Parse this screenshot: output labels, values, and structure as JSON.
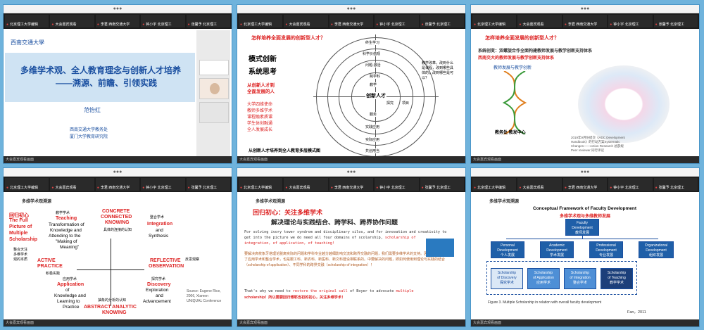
{
  "thumbs": [
    [
      "北京理工大学编辑",
      "大会嘉宾观看",
      "李君 西南交通大学",
      "钟小宇 北京理工",
      "张馨予 北京理工"
    ],
    [
      "北京理工大学编辑",
      "大会嘉宾观看",
      "李君 西南交通大学",
      "钟小宇 北京理工",
      "张馨予 北京理工"
    ],
    [
      "北京理工大学编辑",
      "大会嘉宾观看",
      "李君 西南交通大学",
      "钟小宇 北京理工",
      "张馨予 北京理工"
    ],
    [
      "北京理工大学编辑",
      "大会嘉宾观看",
      "李君 西南交通大学",
      "钟小宇 北京理工",
      "张馨予 北京理工"
    ],
    [
      "北京理工大学编辑",
      "大会嘉宾观看",
      "李君 西南交通大学",
      "钟小宇 北京理工",
      "张馨予 北京理工"
    ],
    [
      "北京理工大学编辑",
      "大会嘉宾观看",
      "李君 西南交通大学",
      "钟小宇 北京理工",
      "张馨予 北京理工"
    ]
  ],
  "bottom_label": "大会嘉宾观看画面",
  "p1": {
    "title_line1": "多维学术观、全人教育理念与创新人才培养",
    "title_line2": "——溯源、前瞻、引领实践",
    "speaker": "范怡红",
    "affil1": "西南交通大学教务处",
    "affil2": "厦门大学教育研究院"
  },
  "p2": {
    "heading": "怎样培养全面发展的创新型人才？",
    "left1": "模式创新",
    "left2": "系统思考",
    "red1": "从创新人才到",
    "red2": "全面发展的人",
    "list": [
      "大学四维使命",
      "教师多维学术",
      "课程融素质课",
      "学生体创融通",
      "全人发展成长"
    ],
    "footer": "从创新人才培养到全人教育多层模式图",
    "center": "创新人才",
    "rings": [
      "终生学习",
      "科学价值观",
      "问题-激活",
      "跨学科",
      "教学",
      "探究",
      "项目",
      "服务",
      "实践应用",
      "实际应用",
      "共创用当"
    ],
    "right_text": "教学改革，改到什么是课程，改到哪些具体的，改到哪些是可以？"
  },
  "p3": {
    "heading": "怎样培养全面发展的创新型人才？",
    "sys1": "系统创变：双螺旋合作全面构建教师发展与教学创新支持体系",
    "sys2": "西南交大的教师发展与教学创新支持体系",
    "left_label": "教师发展与教学创新",
    "bottom_left": "教务处  教发中心",
    "caption1": "2019年9月份提交《ADC Development",
    "caption2": "Handbook》的行动方案Systematic",
    "caption3": "Changes——Action Research 总部规",
    "caption4": "Peer reviewer 同行评议"
  },
  "p4": {
    "section": "多维学术观溯源",
    "l1": "回归初心",
    "l2": "The Full",
    "l3": "Picture of",
    "l4": "Multiple",
    "l5": "Scholarship",
    "l6": "整合天注",
    "l7": "多维学术",
    "l8": "观的本质",
    "teaching_label": "教学学术",
    "teaching": "Teaching",
    "teaching_desc1": "Transformation of",
    "teaching_desc2": "Knowledge and",
    "teaching_desc3": "Attending to the",
    "teaching_desc4": "\"Making of",
    "teaching_desc5": "Meaning\"",
    "concrete1": "CONCRETE",
    "concrete2": "CONNECTED",
    "concrete3": "KNOWING",
    "concrete_cn": "具体的连接的认知",
    "integration_label": "整合学术",
    "integration": "Integration",
    "integration2": "and",
    "integration3": "Synthesis",
    "active1": "ACTIVE",
    "active2": "PRACTICE",
    "active_cn": "积极实践",
    "reflective1": "REFLECTIVE",
    "reflective2": "OBSERVATION",
    "reflective_cn": "反思观察",
    "app_label": "应用学术",
    "application": "Application",
    "application2": "of",
    "application3": "Knowledge and",
    "application4": "Learning to",
    "application5": "Practice",
    "discovery_label": "探究学术",
    "discovery1": "Discovery",
    "discovery2": "Exploration",
    "discovery3": "and",
    "discovery4": "Advancement",
    "abstract1": "ABSTRACT ANALYTIC",
    "abstract2": "KNOWING",
    "abstract_cn": "抽象的分析的认知",
    "source1": "Source: Eugene Rice,",
    "source2": "2006, Xiamen",
    "source3": "UNIQUAL Conference"
  },
  "p5": {
    "section": "多维学术观溯源",
    "heading_red": "回归初心：关注多维学术",
    "heading_black": "解决理论与实践结合、跨学科、跨界协作问题",
    "en1": "For solving ivory tower syndrom and disciplinary silos, and for innovation and creativity to",
    "en2": "get into the picture we do need all four domains of scolarship,",
    "en2_red": "scholarship of",
    "en3_red": "integration, of application, of teaching!",
    "cn1": "要解决高校象牙塔理论脱离实际的问题和学科专业越分越细影响交流和跨界交融的问题，我们需要多维学术的支持。",
    "cn2": "因为多维学术包含了应用学术和整合学术，也是跟工科、新农科、新医科、新文科建设相联系的。",
    "cn3": "中要解决的问题，即如何使用到理论与实践的结合（scholarship of application）、",
    "cn4": "不同学科的跨界交融（scholarship of integration）！",
    "en4": "That's why we need to",
    "en4_red": "restore the original call",
    "en4b": "of Boyer to advocate",
    "en4_red2": "multiple",
    "en5_red": "scholarship！所以需要回归博耶当初的初心，关注多维学术！"
  },
  "p6": {
    "section": "多维学术观溯源",
    "title_en": "Conceptual Framework of Faculty Development",
    "title_cn": "多维学术观与多维教师发展",
    "top1": "Faculty",
    "top2": "Development",
    "top3": "教师发展",
    "mid": [
      [
        "Personal",
        "Development",
        "个人发展"
      ],
      [
        "Academic",
        "Development",
        "学术发展"
      ],
      [
        "Professional",
        "Development",
        "专业发展"
      ],
      [
        "Organizational",
        "Development",
        "组织发展"
      ]
    ],
    "low": [
      [
        "Scholarship",
        "of Discovery",
        "探究学术"
      ],
      [
        "Scholarship",
        "of Application",
        "应用学术"
      ],
      [
        "Scholarship",
        "of Integration",
        "整合学术"
      ],
      [
        "Scholarship",
        "of Teaching",
        "教学学术"
      ]
    ],
    "caption": "Figure 3. Multiple Scholarship in relation with overall faculty development",
    "credit": "Fan，2011"
  }
}
